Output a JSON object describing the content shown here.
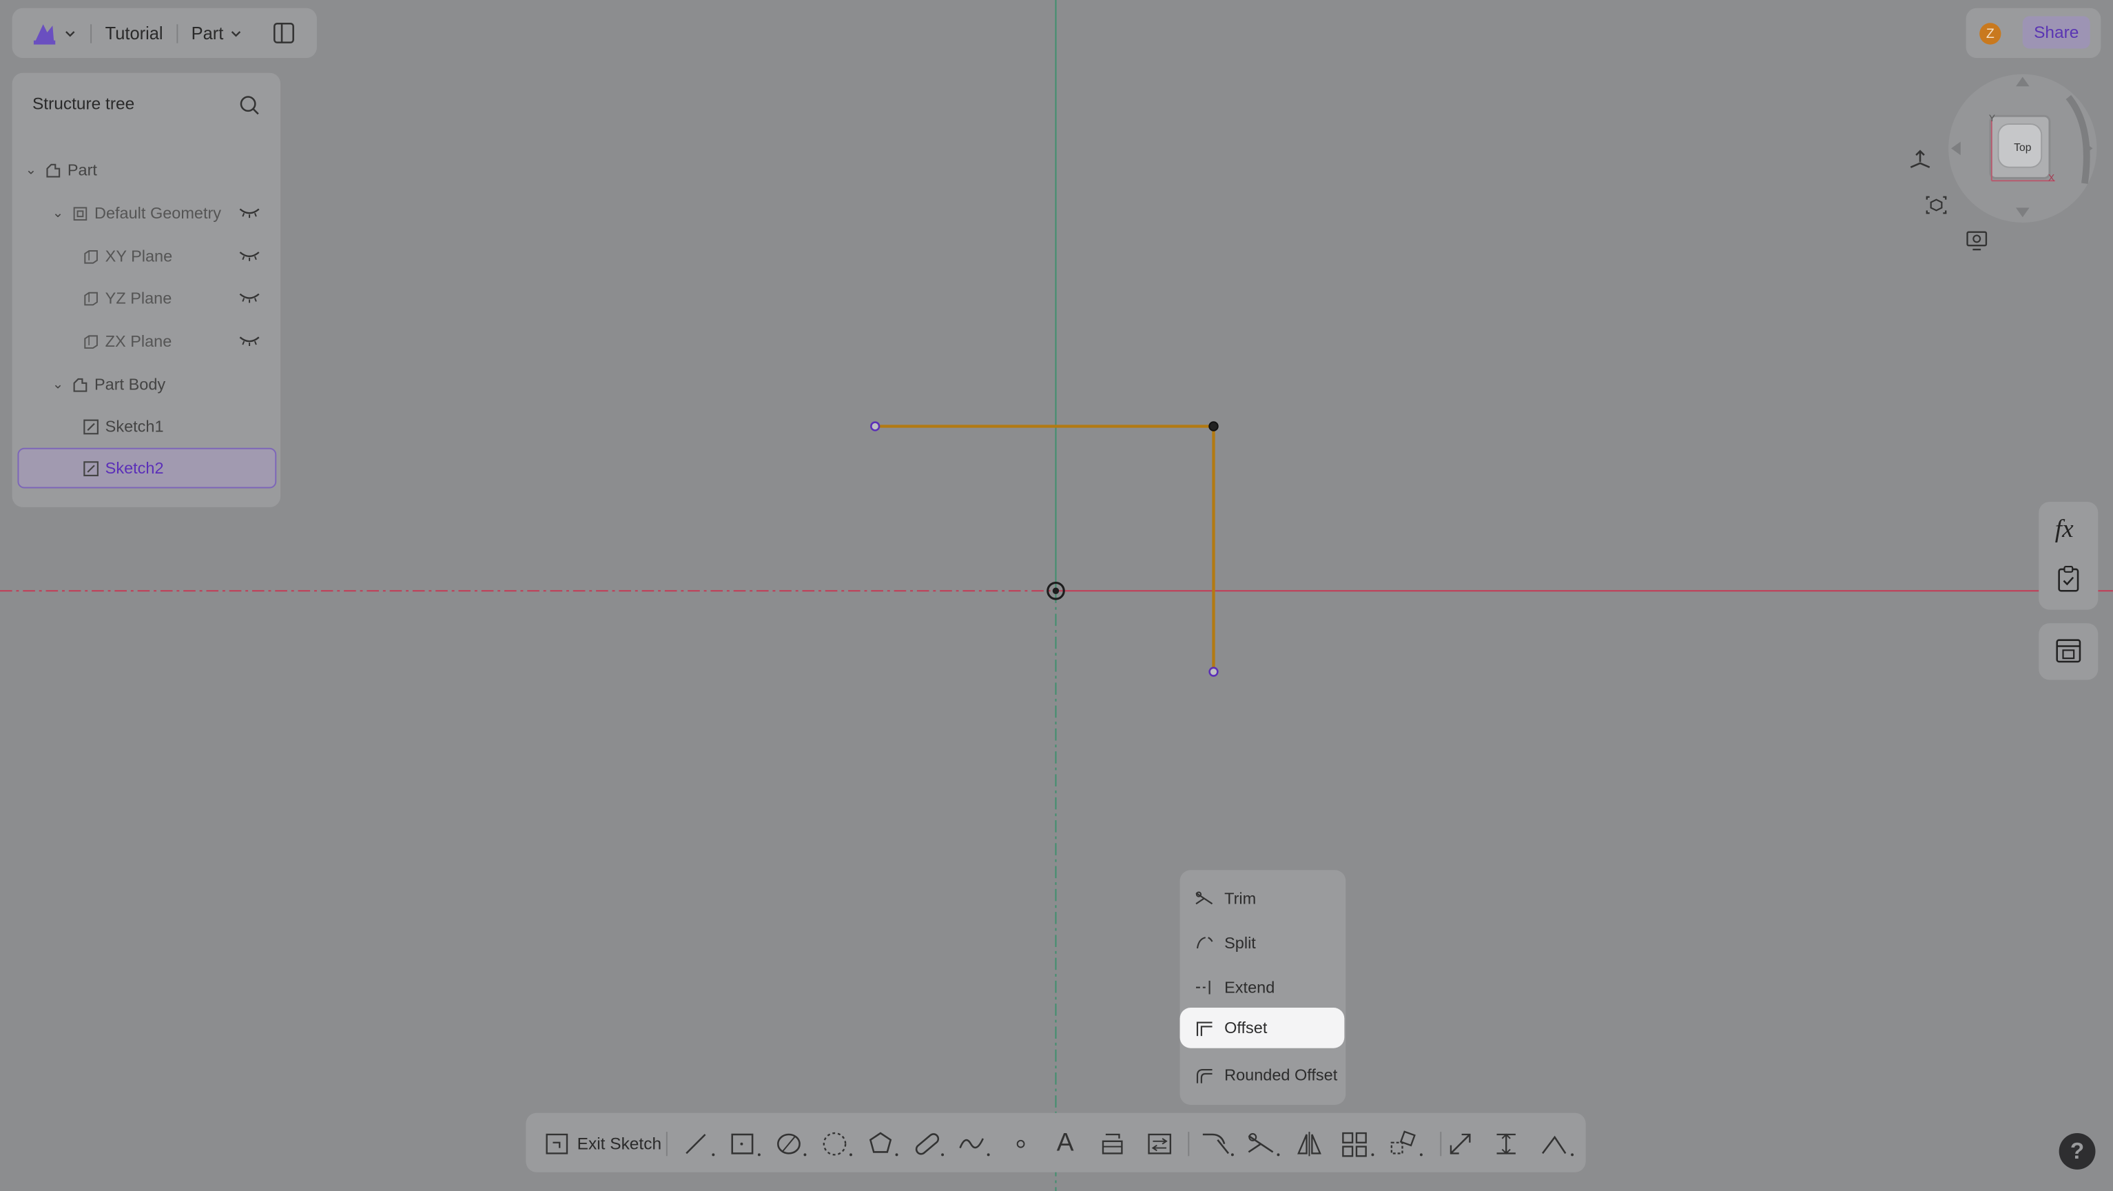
{
  "header": {
    "project_name": "Tutorial",
    "mode_label": "Part",
    "share_label": "Share",
    "avatar_initial": "Z"
  },
  "tree": {
    "title": "Structure tree",
    "items": [
      {
        "label": "Part"
      },
      {
        "label": "Default Geometry"
      },
      {
        "label": "XY Plane"
      },
      {
        "label": "YZ Plane"
      },
      {
        "label": "ZX Plane"
      },
      {
        "label": "Part Body"
      },
      {
        "label": "Sketch1"
      },
      {
        "label": "Sketch2"
      }
    ]
  },
  "viewcube": {
    "face_label": "Top",
    "axis_y": "Y",
    "axis_x": "X"
  },
  "side_panel": {
    "formula_label": "fx"
  },
  "context_menu": {
    "items": [
      {
        "label": "Trim"
      },
      {
        "label": "Split"
      },
      {
        "label": "Extend"
      },
      {
        "label": "Offset"
      },
      {
        "label": "Rounded Offset"
      }
    ],
    "active_item": "Offset"
  },
  "toolbar": {
    "exit_label": "Exit Sketch",
    "text_tool_glyph": "A"
  },
  "help": {
    "label": "?"
  },
  "colors": {
    "canvas": "#8c8d8f",
    "panel": "#9a9b9d",
    "accent": "#5b2fb8",
    "sketch_line": "#b37a12",
    "axis_red": "#c43a55",
    "axis_green": "#3f8f6d"
  }
}
